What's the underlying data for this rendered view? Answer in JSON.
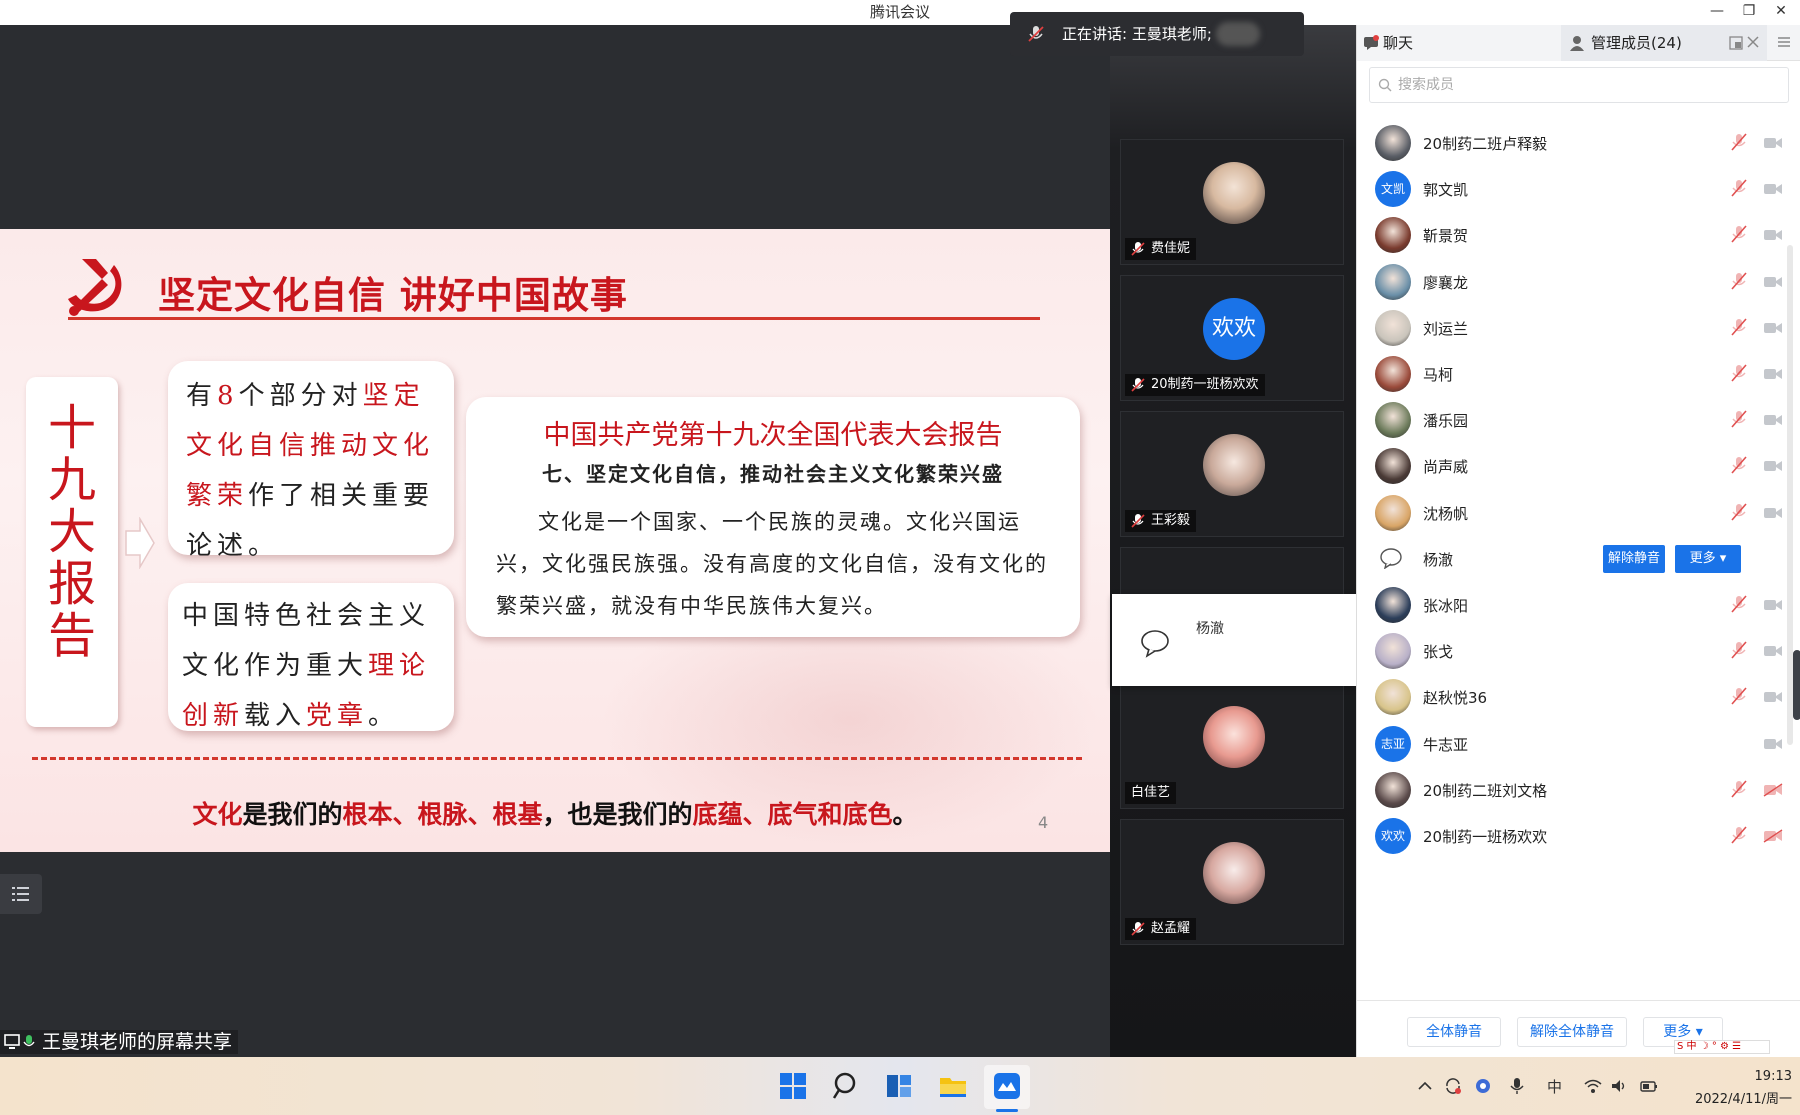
{
  "window": {
    "title": "腾讯会议",
    "controls": [
      "—",
      "❐",
      "✕"
    ]
  },
  "speaking": "正在讲话: 王曼琪老师;",
  "slide": {
    "title": "坚定文化自信 讲好中国故事",
    "vertical_label": [
      "十",
      "九",
      "大",
      "报",
      "告"
    ],
    "card1": {
      "p1": "有",
      "num": "8",
      "p2": "个部分对",
      "hl": "坚定文化自信推动文化繁荣",
      "p3": "作了相关重要论述。"
    },
    "card2": {
      "p1": "中国特色社会主义文化作为重大",
      "hl1": "理论创新",
      "p2": "载入",
      "hl2": "党章",
      "p3": "。"
    },
    "card3": {
      "heading": "中国共产党第十九次全国代表大会报告",
      "subheading": "七、坚定文化自信，推动社会主义文化繁荣兴盛",
      "body": "文化是一个国家、一个民族的灵魂。文化兴国运兴，文化强民族强。没有高度的文化自信，没有文化的繁荣兴盛，就没有中华民族伟大复兴。"
    },
    "bottom": {
      "r1": "文化",
      "b1": "是我们的",
      "r2": "根本、根脉、根基",
      "b2": "，也是我们的",
      "r3": "底蕴、底气和底色",
      "b3": "。"
    },
    "page": "4"
  },
  "share_label": "王曼琪老师的屏幕共享",
  "tiles": [
    {
      "name": "费佳妮",
      "muted": true
    },
    {
      "name": "20制药一班杨欢欢",
      "muted": true,
      "avatar_text": "欢欢"
    },
    {
      "name": "王彩毅",
      "muted": true
    },
    {
      "name": "白佳艺",
      "muted": false
    },
    {
      "name": "赵孟耀",
      "muted": true
    }
  ],
  "chat_popup": {
    "name": "杨澈"
  },
  "panel": {
    "tab_chat": "聊天",
    "tab_members": "管理成员(24)",
    "search_placeholder": "搜索成员",
    "members": [
      {
        "name": "20制药二班卢释毅",
        "color": "#5a5e66"
      },
      {
        "name": "郭文凯",
        "avatar_text": "文凯"
      },
      {
        "name": "靳景贺",
        "color": "#7a3b2e"
      },
      {
        "name": "廖襄龙",
        "color": "#6a8fa8"
      },
      {
        "name": "刘运兰",
        "color": "#c9c4bb"
      },
      {
        "name": "马柯",
        "color": "#9a4a3a"
      },
      {
        "name": "潘乐园",
        "color": "#6b7a5a"
      },
      {
        "name": "尚声威",
        "color": "#4a3a36"
      },
      {
        "name": "沈杨帆",
        "color": "#d9a566"
      },
      {
        "name": "杨澈",
        "active": true
      },
      {
        "name": "张冰阳",
        "color": "#2c3e5a"
      },
      {
        "name": "张戈",
        "color": "#b8b0c8"
      },
      {
        "name": "赵秋悦36",
        "color": "#d8c48a"
      },
      {
        "name": "牛志亚",
        "avatar_text": "志亚",
        "no_mic": true
      },
      {
        "name": "20制药二班刘文格",
        "color": "#5a4a4a"
      },
      {
        "name": "20制药一班杨欢欢",
        "avatar_text": "欢欢"
      }
    ],
    "unmute_btn": "解除静音",
    "more_btn": "更多 ▾",
    "footer": {
      "mute_all": "全体静音",
      "unmute_all": "解除全体静音",
      "more": "更多 ▾"
    }
  },
  "taskbar": {
    "time": "19:13",
    "date": "2022/4/11/周一"
  }
}
